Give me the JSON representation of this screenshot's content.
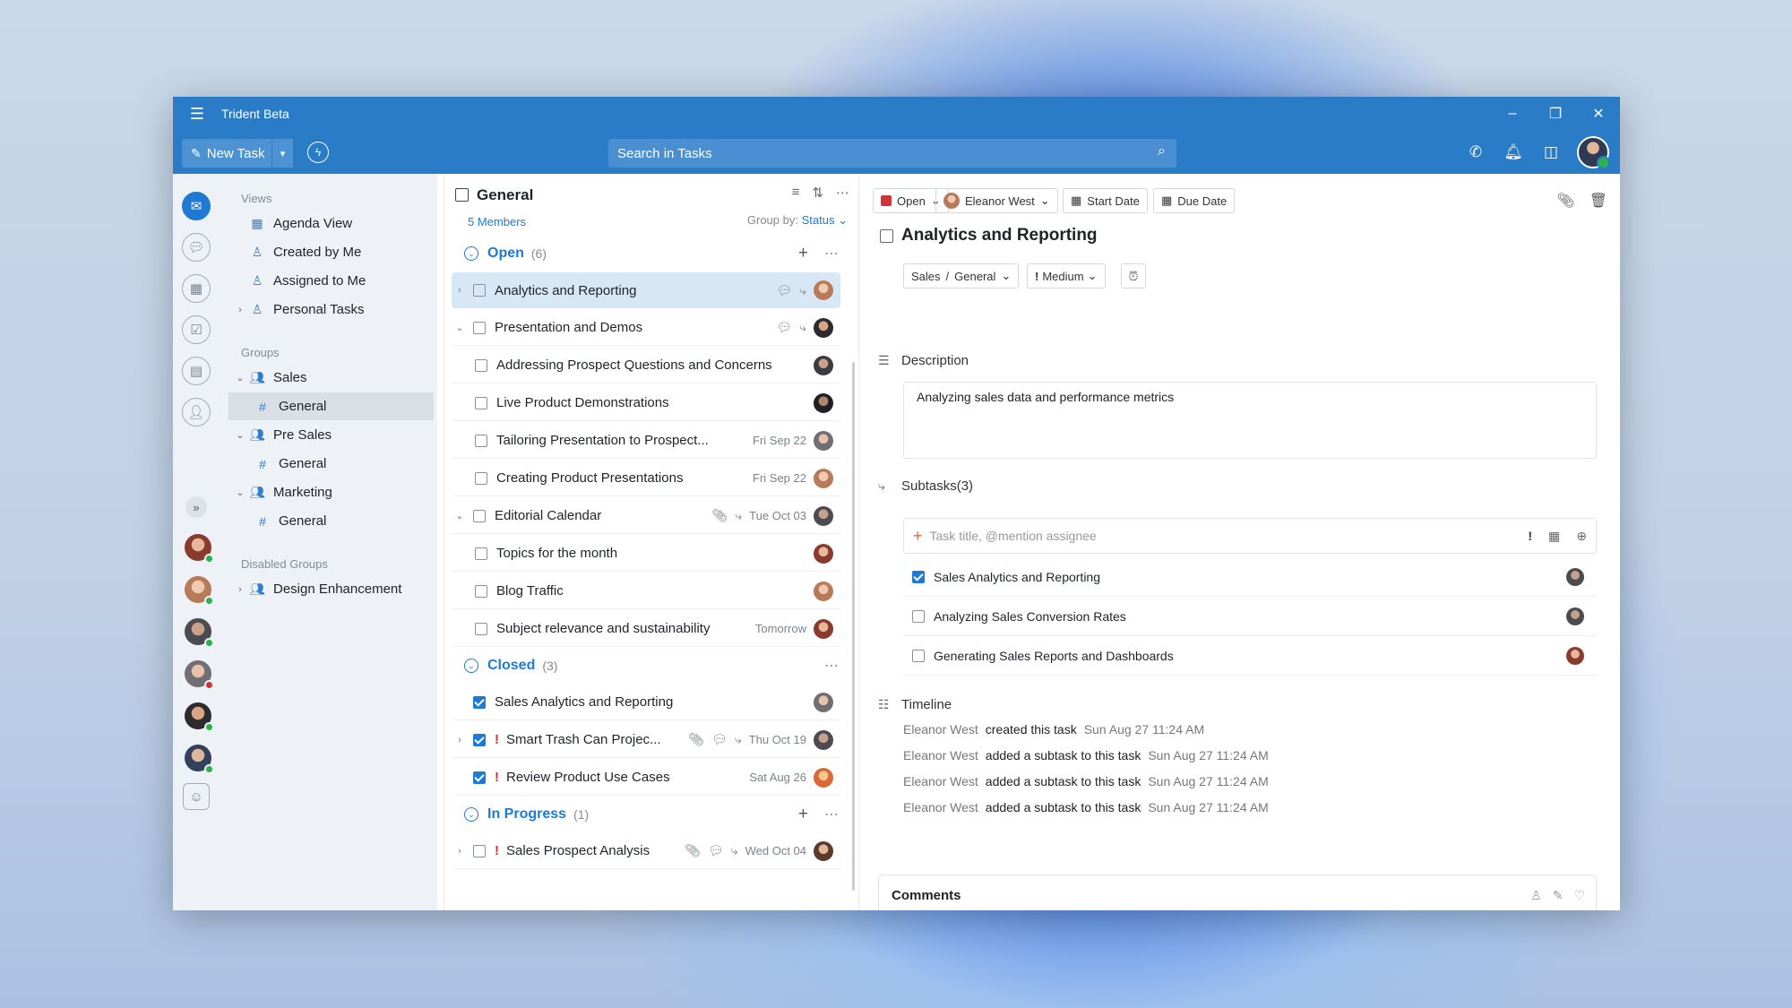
{
  "window": {
    "title": "Trident Beta"
  },
  "toolbar": {
    "new_task": "New Task",
    "search_placeholder": "Search in Tasks"
  },
  "nav": {
    "views_label": "Views",
    "views": [
      {
        "label": "Agenda View",
        "icon": "calendar-icon"
      },
      {
        "label": "Created by Me",
        "icon": "person-icon"
      },
      {
        "label": "Assigned to Me",
        "icon": "person-icon"
      },
      {
        "label": "Personal Tasks",
        "icon": "person-icon"
      }
    ],
    "groups_label": "Groups",
    "groups": [
      {
        "label": "Sales",
        "channel": "General",
        "selected": true
      },
      {
        "label": "Pre Sales",
        "channel": "General"
      },
      {
        "label": "Marketing",
        "channel": "General"
      }
    ],
    "disabled_label": "Disabled Groups",
    "disabled": [
      {
        "label": "Design Enhancement"
      }
    ]
  },
  "list": {
    "title": "General",
    "members": "5 Members",
    "group_by_label": "Group by:",
    "group_by_value": "Status",
    "sections": {
      "open": {
        "name": "Open",
        "count": "(6)"
      },
      "closed": {
        "name": "Closed",
        "count": "(3)"
      },
      "inprogress": {
        "name": "In Progress",
        "count": "(1)"
      }
    },
    "rows": [
      {
        "title": "Analytics and Reporting",
        "date": ""
      },
      {
        "title": "Presentation and Demos",
        "date": ""
      },
      {
        "title": "Addressing Prospect Questions and Concerns",
        "date": ""
      },
      {
        "title": "Live Product Demonstrations",
        "date": ""
      },
      {
        "title": "Tailoring Presentation to Prospect...",
        "date": "Fri Sep 22"
      },
      {
        "title": "Creating Product Presentations",
        "date": "Fri Sep 22"
      },
      {
        "title": "Editorial Calendar",
        "date": "Tue Oct 03"
      },
      {
        "title": "Topics for the month",
        "date": ""
      },
      {
        "title": "Blog Traffic",
        "date": ""
      },
      {
        "title": "Subject relevance and sustainability",
        "date": "Tomorrow"
      },
      {
        "title": "Sales Analytics and Reporting",
        "date": ""
      },
      {
        "title": "Smart Trash Can Projec...",
        "date": "Thu Oct 19"
      },
      {
        "title": "Review Product Use Cases",
        "date": "Sat Aug 26"
      },
      {
        "title": "Sales Prospect Analysis",
        "date": "Wed Oct 04"
      }
    ]
  },
  "detail": {
    "status": "Open",
    "assignee": "Eleanor West",
    "start_date": "Start Date",
    "due_date": "Due Date",
    "title": "Analytics and Reporting",
    "crumb_group": "Sales",
    "crumb_sep": "/",
    "crumb_channel": "General",
    "priority": "Medium",
    "description_label": "Description",
    "description": "Analyzing sales data and performance metrics",
    "subtasks_label": "Subtasks(3)",
    "subtask_placeholder": "Task title, @mention assignee",
    "subtasks": [
      {
        "title": "Sales Analytics and Reporting",
        "done": true
      },
      {
        "title": "Analyzing Sales Conversion Rates",
        "done": false
      },
      {
        "title": "Generating Sales Reports and Dashboards",
        "done": false
      }
    ],
    "timeline_label": "Timeline",
    "timeline": [
      {
        "who": "Eleanor West",
        "what": "created this task",
        "when": "Sun Aug 27 11:24 AM"
      },
      {
        "who": "Eleanor West",
        "what": "added a subtask to this task",
        "when": "Sun Aug 27 11:24 AM"
      },
      {
        "who": "Eleanor West",
        "what": "added a subtask to this task",
        "when": "Sun Aug 27 11:24 AM"
      },
      {
        "who": "Eleanor West",
        "what": "added a subtask to this task",
        "when": "Sun Aug 27 11:24 AM"
      }
    ],
    "comments_label": "Comments"
  },
  "colors": {
    "accent": "#2a7cc7",
    "link": "#1e7ad2",
    "important": "#d13438",
    "online": "#2bb24c",
    "busy": "#d13438"
  }
}
